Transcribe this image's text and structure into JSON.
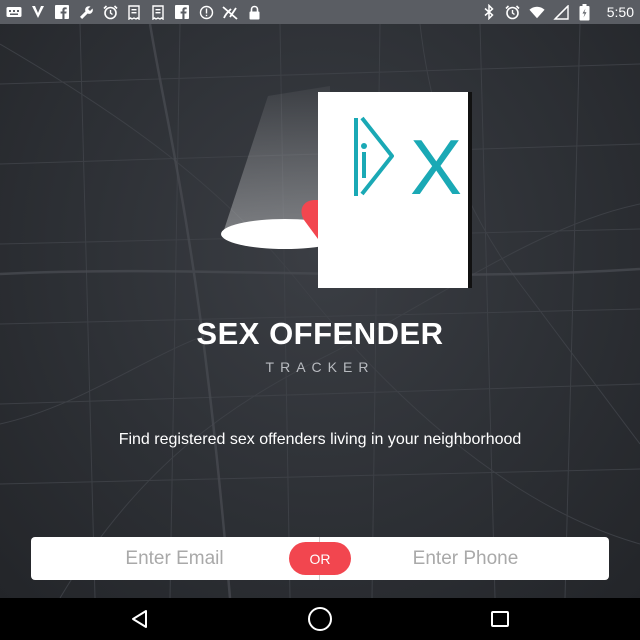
{
  "status_bar": {
    "time": "5:50",
    "left_icons": [
      "keyboard-icon",
      "v-icon",
      "facebook-icon",
      "wrench-icon",
      "alarm-icon",
      "receipt-icon",
      "receipt-icon",
      "facebook-icon",
      "info-icon",
      "no-signal-icon",
      "lock-icon"
    ],
    "right_icons": [
      "bluetooth-icon",
      "alarm-icon",
      "wifi-icon",
      "signal-icon",
      "battery-icon"
    ]
  },
  "app": {
    "title": "SEX OFFENDER",
    "subtitle": "TRACKER",
    "tagline": "Find registered sex offenders living in your neighborhood"
  },
  "form": {
    "email_placeholder": "Enter Email",
    "phone_placeholder": "Enter Phone",
    "or_label": "OR"
  },
  "ad": {
    "logo_text": "X"
  },
  "colors": {
    "accent": "#f2464f",
    "background": "#2b2d31",
    "ad_logo": "#1aa9b5"
  },
  "nav": {
    "icons": [
      "back-icon",
      "home-icon",
      "recents-icon"
    ]
  }
}
